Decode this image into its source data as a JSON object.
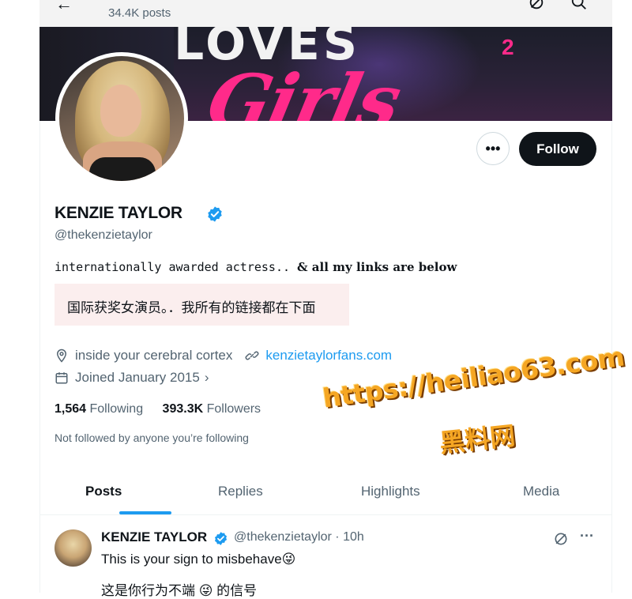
{
  "header": {
    "posts_count": "34.4K posts",
    "back_icon": "back-arrow-icon",
    "icons": [
      "grok-icon",
      "search-icon"
    ]
  },
  "banner": {
    "title_main": "Girls",
    "title_top": "LOVES",
    "title_sup": "2"
  },
  "profile": {
    "name": "KENZIE TAYLOR",
    "handle": "@thekenzietaylor",
    "bio": "internationally awarded actress.. & all my links are below",
    "bio_plain": "internationally awarded actress.. ",
    "bio_bold": "& all my links are below",
    "translation": "国际获奖女演员。．我所有的链接都在下面",
    "location": "inside your cerebral cortex",
    "website": "kenzietaylorfans.com",
    "joined": "Joined January 2015",
    "following_count": "1,564",
    "following_label": "Following",
    "followers_count": "393.3K",
    "followers_label": "Followers",
    "not_followed": "Not followed by anyone you’re following",
    "more_label": "•••",
    "follow_label": "Follow"
  },
  "watermark": {
    "line1": "https://heiliao63.com",
    "line2": "黑料网"
  },
  "tabs": [
    {
      "label": "Posts",
      "active": true
    },
    {
      "label": "Replies",
      "active": false
    },
    {
      "label": "Highlights",
      "active": false
    },
    {
      "label": "Media",
      "active": false
    }
  ],
  "post": {
    "author": "KENZIE TAYLOR",
    "handle_time": "@thekenzietaylor · 10h",
    "text1": "This is your sign to misbehave😜",
    "text2": "这是你行为不端 😜 的信号",
    "more_label": "···"
  },
  "colors": {
    "accent": "#1d9bf0",
    "text": "#0f1419",
    "muted": "#536471",
    "follow_bg": "#0f1419",
    "banner_pink": "#ff2a8a",
    "watermark": "#f5a623"
  }
}
